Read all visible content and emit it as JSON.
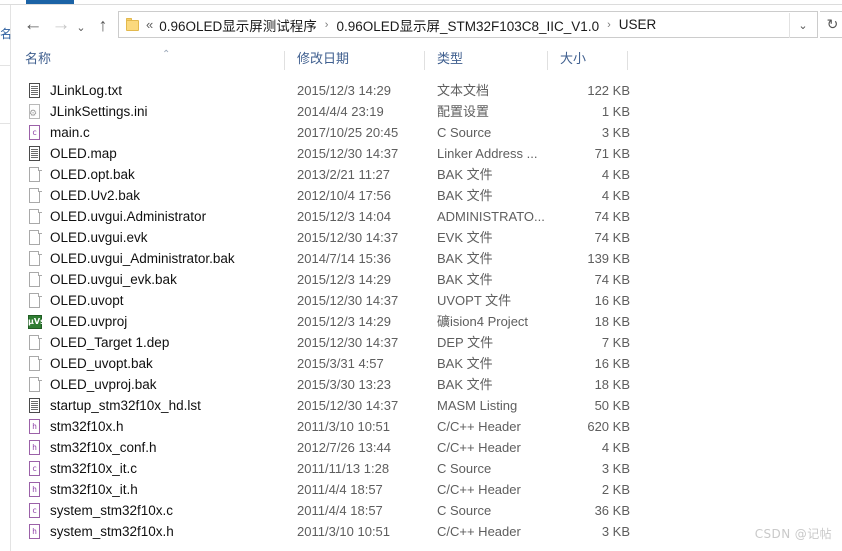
{
  "window": {
    "tab_accent_color": "#1b63a6",
    "left_pane_glyph": "名"
  },
  "toolbar": {
    "back_icon": "←",
    "forward_icon": "→",
    "recent_icon": "⌄",
    "up_icon": "↑",
    "dropdown_icon": "⌄",
    "refresh_icon": "↻"
  },
  "address": {
    "folder_icon": "folder-icon",
    "overflow_marker": "«",
    "separator": "›",
    "crumbs": [
      "0.96OLED显示屏测试程序",
      "0.96OLED显示屏_STM32F103C8_IIC_V1.0",
      "USER"
    ]
  },
  "columns": {
    "name": "名称",
    "date": "修改日期",
    "type": "类型",
    "size": "大小",
    "sort_caret": "⌃"
  },
  "files": [
    {
      "name": "JLinkLog.txt",
      "date": "2015/12/3 14:29",
      "type": "文本文档",
      "size": "122 KB",
      "icon": "text-file-icon",
      "letter": ""
    },
    {
      "name": "JLinkSettings.ini",
      "date": "2014/4/4 23:19",
      "type": "配置设置",
      "size": "1 KB",
      "icon": "ini-file-icon",
      "letter": ""
    },
    {
      "name": "main.c",
      "date": "2017/10/25 20:45",
      "type": "C Source",
      "size": "3 KB",
      "icon": "c-source-icon",
      "letter": "c"
    },
    {
      "name": "OLED.map",
      "date": "2015/12/30 14:37",
      "type": "Linker Address ...",
      "size": "71 KB",
      "icon": "text-file-icon",
      "letter": ""
    },
    {
      "name": "OLED.opt.bak",
      "date": "2013/2/21 11:27",
      "type": "BAK 文件",
      "size": "4 KB",
      "icon": "blank-file-icon",
      "letter": ""
    },
    {
      "name": "OLED.Uv2.bak",
      "date": "2012/10/4 17:56",
      "type": "BAK 文件",
      "size": "4 KB",
      "icon": "blank-file-icon",
      "letter": ""
    },
    {
      "name": "OLED.uvgui.Administrator",
      "date": "2015/12/3 14:04",
      "type": "ADMINISTRATO...",
      "size": "74 KB",
      "icon": "blank-file-icon",
      "letter": ""
    },
    {
      "name": "OLED.uvgui.evk",
      "date": "2015/12/30 14:37",
      "type": "EVK 文件",
      "size": "74 KB",
      "icon": "blank-file-icon",
      "letter": ""
    },
    {
      "name": "OLED.uvgui_Administrator.bak",
      "date": "2014/7/14 15:36",
      "type": "BAK 文件",
      "size": "139 KB",
      "icon": "blank-file-icon",
      "letter": ""
    },
    {
      "name": "OLED.uvgui_evk.bak",
      "date": "2015/12/3 14:29",
      "type": "BAK 文件",
      "size": "74 KB",
      "icon": "blank-file-icon",
      "letter": ""
    },
    {
      "name": "OLED.uvopt",
      "date": "2015/12/30 14:37",
      "type": "UVOPT 文件",
      "size": "16 KB",
      "icon": "blank-file-icon",
      "letter": ""
    },
    {
      "name": "OLED.uvproj",
      "date": "2015/12/3 14:29",
      "type": "礦ision4 Project",
      "size": "18 KB",
      "icon": "keil-uvision-icon",
      "letter": "µVs"
    },
    {
      "name": "OLED_Target 1.dep",
      "date": "2015/12/30 14:37",
      "type": "DEP 文件",
      "size": "7 KB",
      "icon": "blank-file-icon",
      "letter": ""
    },
    {
      "name": "OLED_uvopt.bak",
      "date": "2015/3/31 4:57",
      "type": "BAK 文件",
      "size": "16 KB",
      "icon": "blank-file-icon",
      "letter": ""
    },
    {
      "name": "OLED_uvproj.bak",
      "date": "2015/3/30 13:23",
      "type": "BAK 文件",
      "size": "18 KB",
      "icon": "blank-file-icon",
      "letter": ""
    },
    {
      "name": "startup_stm32f10x_hd.lst",
      "date": "2015/12/30 14:37",
      "type": "MASM Listing",
      "size": "50 KB",
      "icon": "text-file-icon",
      "letter": ""
    },
    {
      "name": "stm32f10x.h",
      "date": "2011/3/10 10:51",
      "type": "C/C++ Header",
      "size": "620 KB",
      "icon": "h-source-icon",
      "letter": "h"
    },
    {
      "name": "stm32f10x_conf.h",
      "date": "2012/7/26 13:44",
      "type": "C/C++ Header",
      "size": "4 KB",
      "icon": "h-source-icon",
      "letter": "h"
    },
    {
      "name": "stm32f10x_it.c",
      "date": "2011/11/13 1:28",
      "type": "C Source",
      "size": "3 KB",
      "icon": "c-source-icon",
      "letter": "c"
    },
    {
      "name": "stm32f10x_it.h",
      "date": "2011/4/4 18:57",
      "type": "C/C++ Header",
      "size": "2 KB",
      "icon": "h-source-icon",
      "letter": "h"
    },
    {
      "name": "system_stm32f10x.c",
      "date": "2011/4/4 18:57",
      "type": "C Source",
      "size": "36 KB",
      "icon": "c-source-icon",
      "letter": "c"
    },
    {
      "name": "system_stm32f10x.h",
      "date": "2011/3/10 10:51",
      "type": "C/C++ Header",
      "size": "3 KB",
      "icon": "h-source-icon",
      "letter": "h"
    }
  ],
  "watermark": "CSDN @记帖"
}
